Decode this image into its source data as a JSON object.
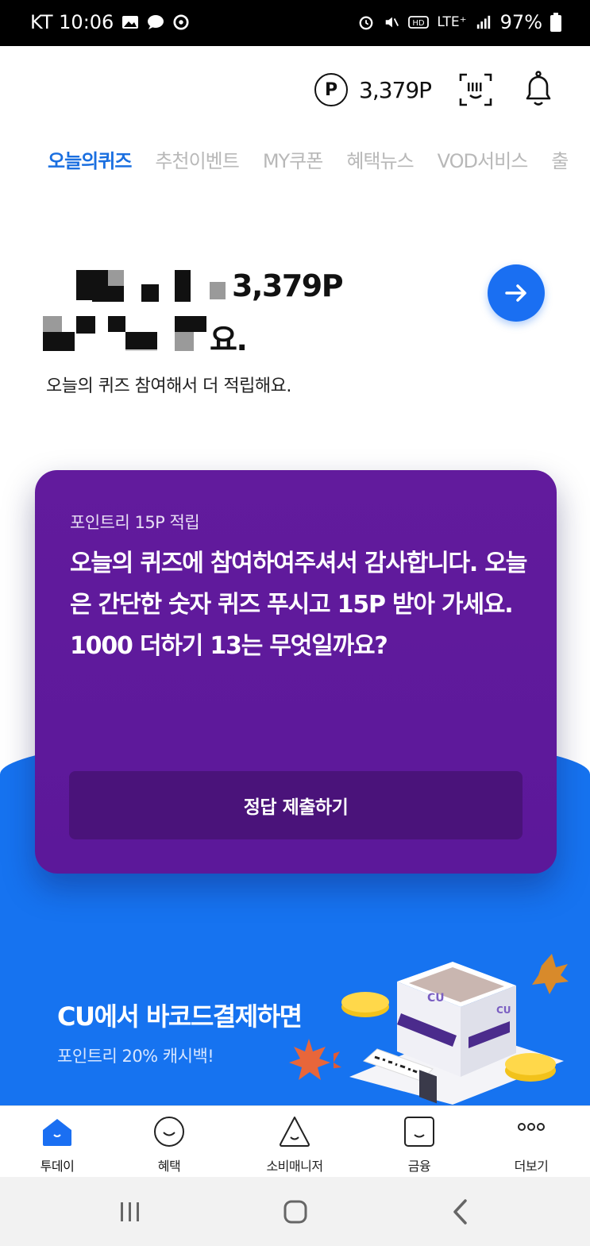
{
  "status_bar": {
    "carrier_time": "KT 10:06",
    "network": "LTE⁺",
    "battery": "97%"
  },
  "header": {
    "points": "3,379P",
    "points_icon": "P"
  },
  "tabs": [
    {
      "label": "오늘의퀴즈",
      "active": true
    },
    {
      "label": "추천이벤트",
      "active": false
    },
    {
      "label": "MY쿠폰",
      "active": false
    },
    {
      "label": "혜택뉴스",
      "active": false
    },
    {
      "label": "VOD서비스",
      "active": false
    },
    {
      "label": "출",
      "active": false
    }
  ],
  "hero": {
    "line1_visible": "3,379P",
    "line2_visible": "요.",
    "subtitle": "오늘의 퀴즈 참여해서 더 적립해요."
  },
  "quiz": {
    "reward": "포인트리 15P 적립",
    "text": "오늘의 퀴즈에 참여하여주셔서 감사합니다. 오늘은 간단한 숫자 퀴즈 푸시고 15P 받아 가세요. 1000 더하기 13는 무엇일까요?",
    "submit_label": "정답 제출하기"
  },
  "promo": {
    "title": "CU에서 바코드결제하면",
    "subtitle": "포인트리 20% 캐시백!",
    "store_logo": "CU"
  },
  "bottom_nav": [
    {
      "label": "투데이",
      "icon": "home-face-icon",
      "active": true
    },
    {
      "label": "혜택",
      "icon": "smile-circle-icon",
      "active": false
    },
    {
      "label": "소비매니저",
      "icon": "triangle-face-icon",
      "active": false
    },
    {
      "label": "금융",
      "icon": "square-face-icon",
      "active": false
    },
    {
      "label": "더보기",
      "icon": "more-dots-icon",
      "active": false
    }
  ],
  "colors": {
    "accent_blue": "#1673f0",
    "quiz_purple": "#5e1a99",
    "button_purple": "#4a137a",
    "tab_active": "#1a6fe0"
  }
}
